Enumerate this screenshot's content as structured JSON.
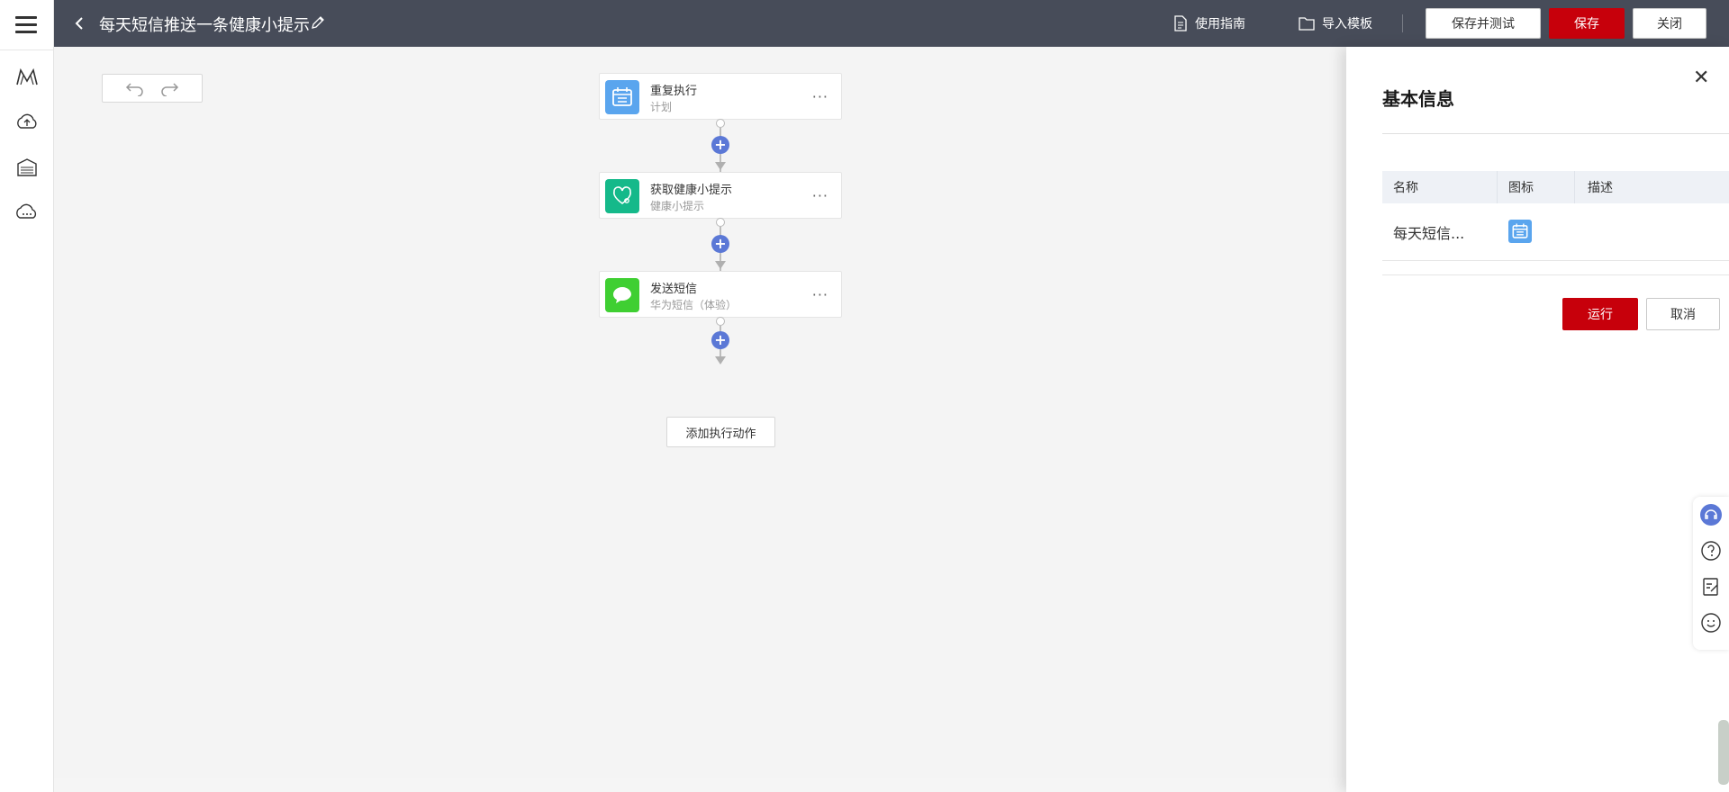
{
  "header": {
    "title": "每天短信推送一条健康小提示",
    "guide_label": "使用指南",
    "import_label": "导入模板",
    "save_test_label": "保存并测试",
    "save_label": "保存",
    "close_label": "关闭"
  },
  "sidebar": {
    "items": [
      {
        "icon": "menu-icon"
      },
      {
        "icon": "mountain-logo-icon"
      },
      {
        "icon": "cloud-upload-icon"
      },
      {
        "icon": "warehouse-icon"
      },
      {
        "icon": "cloud-chat-icon"
      }
    ]
  },
  "flow": {
    "nodes": [
      {
        "title": "重复执行",
        "subtitle": "计划",
        "icon": "calendar-icon",
        "color": "#5aa5ee"
      },
      {
        "title": "获取健康小提示",
        "subtitle": "健康小提示",
        "icon": "health-heart-icon",
        "color": "#15b98a"
      },
      {
        "title": "发送短信",
        "subtitle": "华为短信（体验）",
        "icon": "message-bubble-icon",
        "color": "#3fcf32"
      }
    ],
    "more_label": "···",
    "add_action_label": "添加执行动作"
  },
  "panel": {
    "title": "基本信息",
    "columns": [
      "名称",
      "图标",
      "描述"
    ],
    "row": {
      "name": "每天短信...",
      "icon": "calendar-icon",
      "description": ""
    },
    "run_label": "运行",
    "cancel_label": "取消"
  },
  "colors": {
    "topbar": "#474c59",
    "primary_red": "#c7000b",
    "plus_blue": "#5b78d6"
  }
}
